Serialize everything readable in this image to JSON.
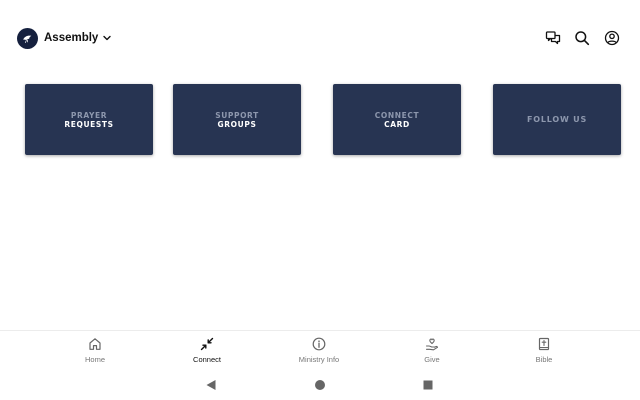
{
  "header": {
    "org_name": "Assembly",
    "logo_icon": "bird-logo-icon",
    "actions": [
      {
        "icon": "chat-bubbles-icon"
      },
      {
        "icon": "search-icon"
      },
      {
        "icon": "account-circle-icon"
      }
    ]
  },
  "cards": [
    {
      "line1": "PRAYER",
      "line2": "REQUESTS"
    },
    {
      "line1": "SUPPORT",
      "line2": "GROUPS"
    },
    {
      "line1": "CONNECT",
      "line2": "CARD"
    },
    {
      "line1": "FOLLOW US",
      "line2": ""
    }
  ],
  "bottom_nav": {
    "active": "Connect",
    "items": [
      {
        "label": "Home",
        "icon": "home-icon"
      },
      {
        "label": "Connect",
        "icon": "connect-arrows-icon"
      },
      {
        "label": "Ministry Info",
        "icon": "info-icon"
      },
      {
        "label": "Give",
        "icon": "give-hand-heart-icon"
      },
      {
        "label": "Bible",
        "icon": "bible-icon"
      }
    ]
  },
  "system_nav": [
    "back-triangle-icon",
    "home-circle-icon",
    "recents-square-icon"
  ],
  "colors": {
    "card_bg": "#273452",
    "card_text_dim": "#8d97ad",
    "card_text_bright": "#ffffff",
    "logo_bg": "#15203e",
    "nav_active": "#111111",
    "nav_inactive": "#777777"
  }
}
